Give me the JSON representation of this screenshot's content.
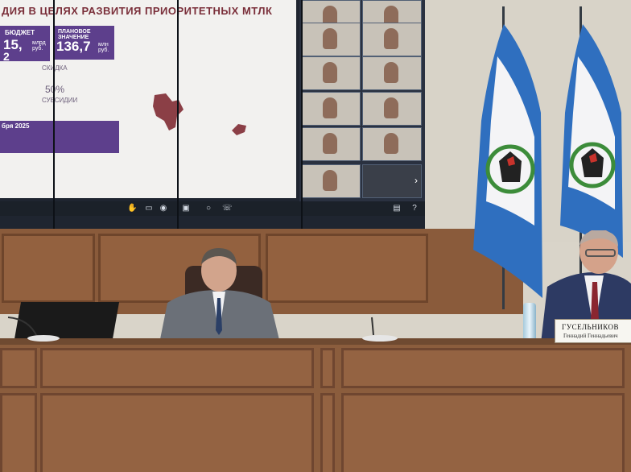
{
  "slide": {
    "title": "ДИЯ В ЦЕЛЯХ РАЗВИТИЯ ПРИОРИТЕТНЫХ МТЛК",
    "kpi_budget_label": "БЮДЖЕТ",
    "kpi_budget_value": "15,",
    "kpi_budget_unit": "млрд руб.",
    "kpi_budget_value2": "2",
    "kpi_plan_label": "ПЛАНОВОЕ ЗНАЧЕНИЕ",
    "kpi_plan_value": "136,7",
    "kpi_plan_unit": "млн руб.",
    "subsidy_label": "СКИДКА",
    "subsidy_value": "50%",
    "subsidy_label2": "СУБСИДИИ",
    "date_label": "бря 2025"
  },
  "nameplate": {
    "surname": "ГУСЕЛЬНИКОВ",
    "name": "Геннадий Геннадьевич"
  },
  "colors": {
    "slide_accent": "#5d3f8c",
    "title_color": "#7a2f3a",
    "flag_blue": "#2f6fbf",
    "wood": "#8a5b3b"
  }
}
